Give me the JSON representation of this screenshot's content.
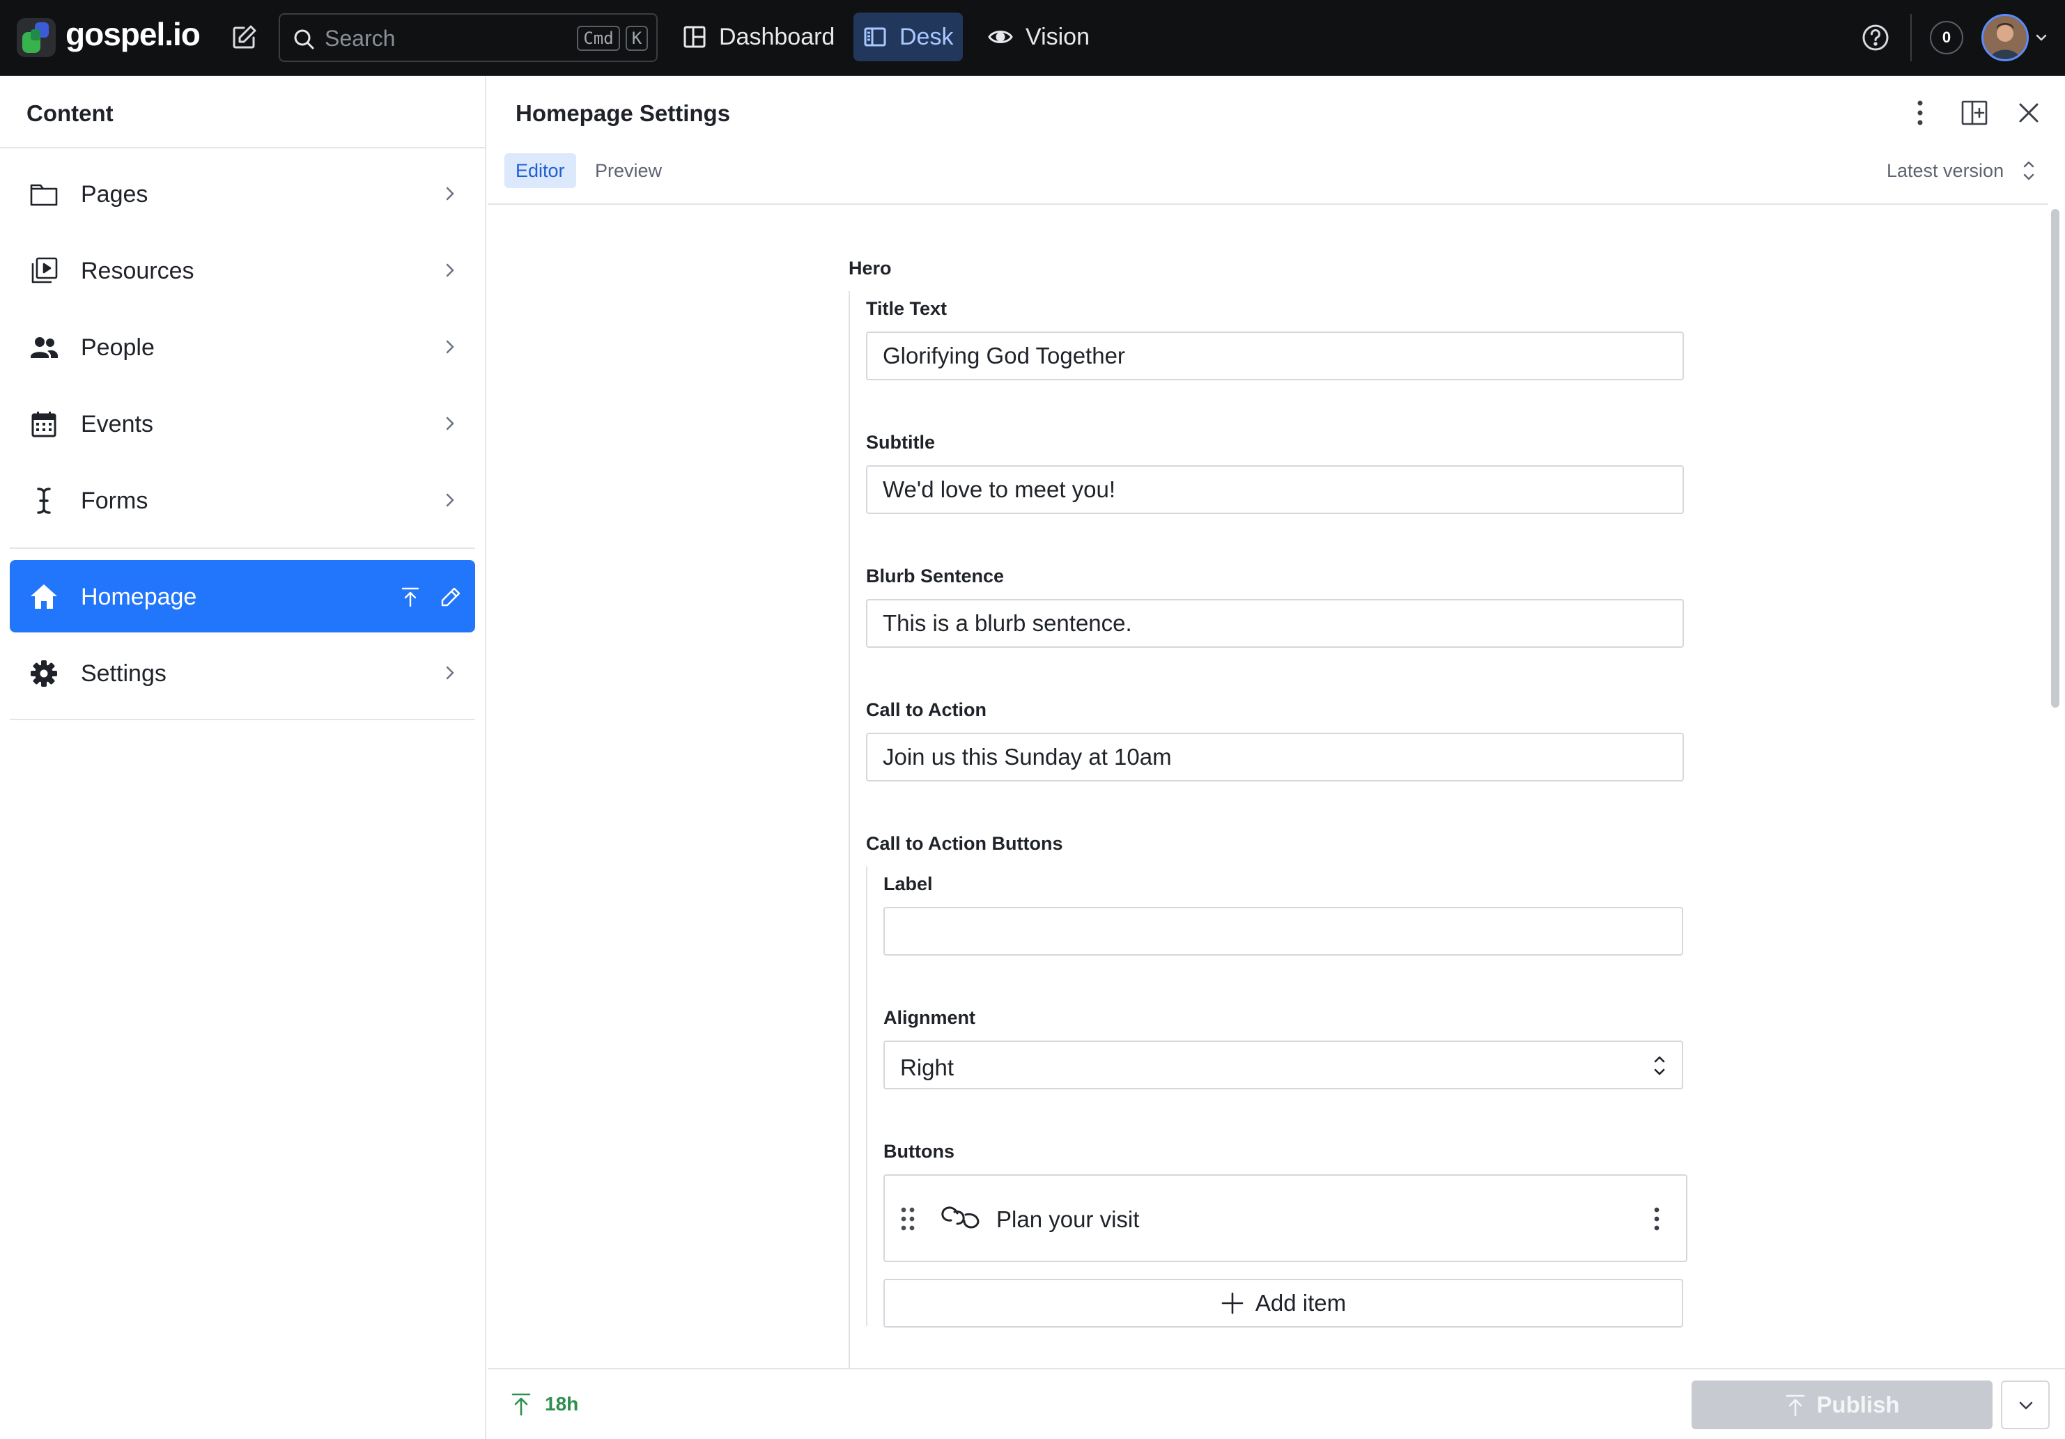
{
  "app": {
    "name": "gospel.io"
  },
  "search": {
    "placeholder": "Search",
    "shortcut_mod": "Cmd",
    "shortcut_key": "K"
  },
  "nav": {
    "tabs": [
      {
        "label": "Dashboard",
        "icon": "dashboard-icon",
        "active": false
      },
      {
        "label": "Desk",
        "icon": "desk-icon",
        "active": true
      },
      {
        "label": "Vision",
        "icon": "eye-icon",
        "active": false
      }
    ]
  },
  "topbar": {
    "notification_count": "0"
  },
  "sidebar": {
    "title": "Content",
    "items": [
      {
        "label": "Pages",
        "icon": "folder-icon"
      },
      {
        "label": "Resources",
        "icon": "media-library-icon"
      },
      {
        "label": "People",
        "icon": "people-icon"
      },
      {
        "label": "Events",
        "icon": "calendar-icon"
      },
      {
        "label": "Forms",
        "icon": "text-cursor-icon"
      },
      {
        "label": "Homepage",
        "icon": "home-icon",
        "active": true
      },
      {
        "label": "Settings",
        "icon": "gear-icon"
      }
    ]
  },
  "pane": {
    "title": "Homepage Settings",
    "tabs": [
      {
        "label": "Editor",
        "active": true
      },
      {
        "label": "Preview",
        "active": false
      }
    ],
    "version": "Latest version"
  },
  "form": {
    "hero_label": "Hero",
    "title_text": {
      "label": "Title Text",
      "value": "Glorifying God Together"
    },
    "subtitle": {
      "label": "Subtitle",
      "value": "We'd love to meet you!"
    },
    "blurb": {
      "label": "Blurb Sentence",
      "value": "This is a blurb sentence."
    },
    "cta": {
      "label": "Call to Action",
      "value": "Join us this Sunday at 10am"
    },
    "cta_buttons": {
      "label": "Call to Action Buttons",
      "label_field": {
        "label": "Label",
        "value": ""
      },
      "alignment": {
        "label": "Alignment",
        "value": "Right"
      },
      "buttons": {
        "label": "Buttons",
        "items": [
          {
            "label": "Plan your visit",
            "icon": "link-icon"
          }
        ],
        "add_label": "Add item"
      }
    }
  },
  "footer": {
    "status_time": "18h",
    "publish_label": "Publish"
  },
  "colors": {
    "topbar_bg": "#101112",
    "accent": "#2276fc",
    "desk_tab_bg": "#21385c",
    "status_green": "#2f8f4e",
    "publish_disabled": "#c7cbd1"
  }
}
